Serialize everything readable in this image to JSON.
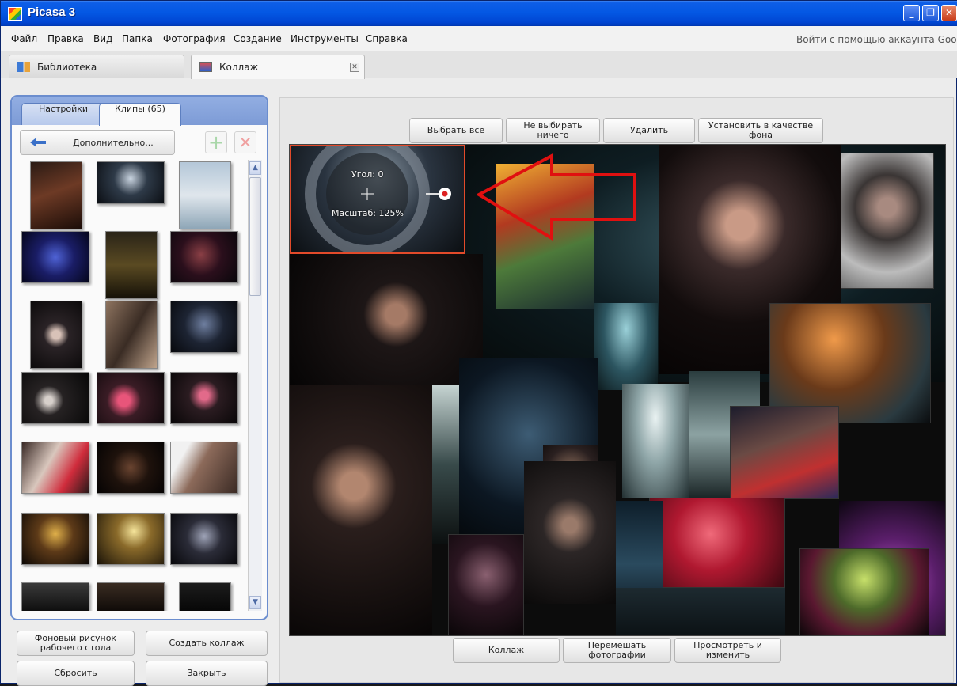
{
  "window": {
    "title": "Picasa 3",
    "controls": {
      "minimize": "_",
      "maximize": "❐",
      "close": "✕"
    }
  },
  "menu": {
    "items": [
      "Файл",
      "Правка",
      "Вид",
      "Папка",
      "Фотография",
      "Создание",
      "Инструменты",
      "Справка"
    ],
    "signin": "Войти с помощью аккаунта Googl"
  },
  "doc_tabs": {
    "library": "Библиотека",
    "collage": "Коллаж",
    "close_glyph": "✕"
  },
  "left_panel": {
    "tabs": {
      "settings": "Настройки",
      "clips": "Клипы (65)"
    },
    "back_button": "Дополнительно...",
    "add_glyph": "+",
    "remove_glyph": "✕",
    "scroll_up": "▲",
    "scroll_down": "▼"
  },
  "bottom_left_buttons": {
    "wallpaper": "Фоновый рисунок рабочего стола",
    "create_collage": "Создать коллаж",
    "reset": "Сбросить",
    "close": "Закрыть"
  },
  "top_buttons": {
    "select_all": "Выбрать все",
    "select_none": "Не выбирать ничего",
    "delete": "Удалить",
    "set_background": "Установить в качестве фона"
  },
  "bottom_buttons": {
    "collage": "Коллаж",
    "shuffle": "Перемешать фотографии",
    "view_edit": "Просмотреть и изменить"
  },
  "rotate_dial": {
    "angle": "Угол: 0",
    "scale": "Масштаб: 125%"
  },
  "colors": {
    "titlebar": "#0458e4",
    "panel_border": "#6b8dce",
    "selection": "#e24a2a",
    "arrow": "#e01010"
  }
}
